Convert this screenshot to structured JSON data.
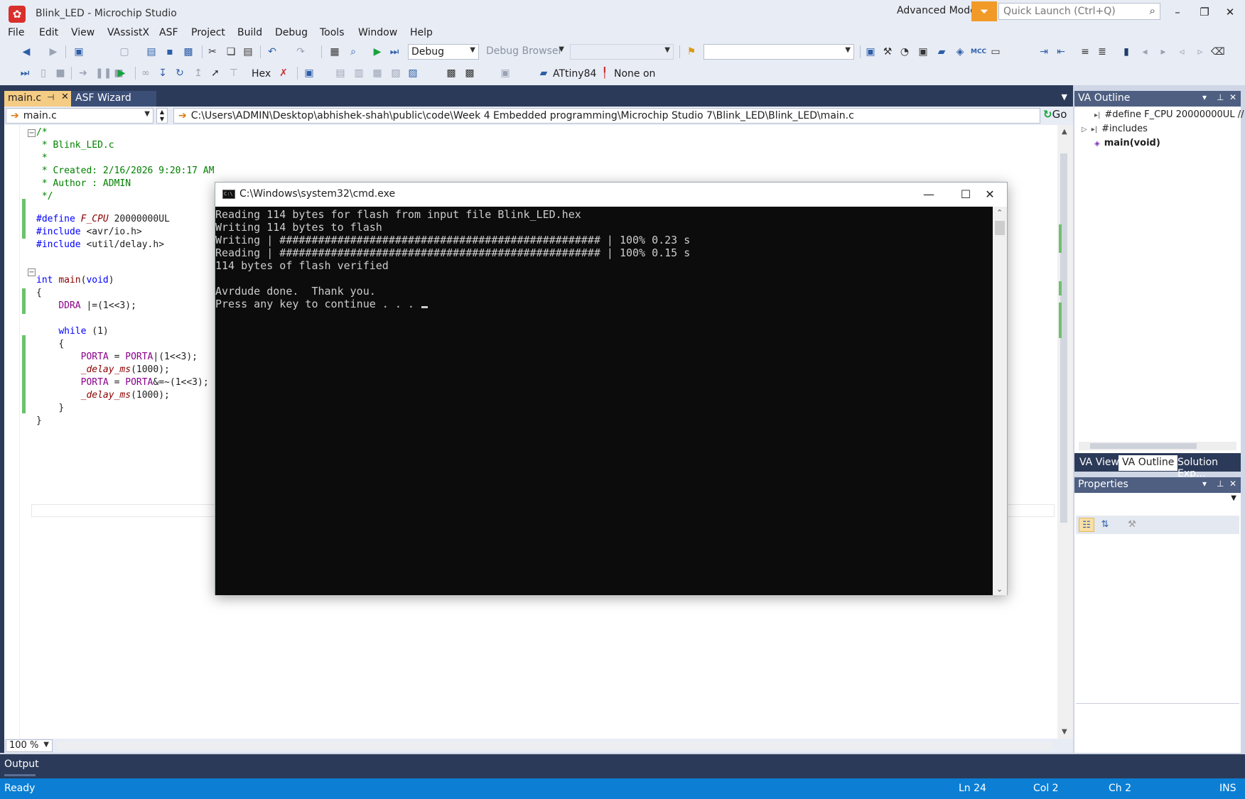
{
  "window": {
    "title": "Blink_LED - Microchip Studio",
    "advanced_mode": "Advanced Mode",
    "quick_launch_placeholder": "Quick Launch (Ctrl+Q)"
  },
  "menu": [
    "File",
    "Edit",
    "View",
    "VAssistX",
    "ASF",
    "Project",
    "Build",
    "Debug",
    "Tools",
    "Window",
    "Help"
  ],
  "toolbar": {
    "config": "Debug",
    "debug_browser": "Debug Browser",
    "hex_label": "Hex",
    "device": "ATtiny84",
    "tool": "None on"
  },
  "tabs": {
    "main": "main.c",
    "asf": "ASF Wizard"
  },
  "navbar": {
    "file": "main.c",
    "path": "C:\\Users\\ADMIN\\Desktop\\abhishek-shah\\public\\code\\Week 4 Embedded programming\\Microchip Studio 7\\Blink_LED\\Blink_LED\\main.c",
    "go": "Go"
  },
  "code": {
    "l1": "/*",
    "l2": " * Blink_LED.c",
    "l3": " *",
    "l4": " * Created: 2/16/2026 9:20:17 AM",
    "l5": " * Author : ADMIN",
    "l6": " */",
    "define_kw": "#define",
    "define_name": "F_CPU",
    "define_val": " 20000000UL",
    "inc_kw": "#include",
    "inc1": " <avr/io.h>",
    "inc2": " <util/delay.h>",
    "int_kw": "int",
    "main_name": "main",
    "main_args": "(",
    "void_kw": "void",
    "close_paren": ")",
    "brace_open": "{",
    "ddra": "DDRA",
    "ddra_rest": " |=(1<<3);",
    "while_kw": "while",
    "while_rest": " (1)",
    "inner_open": "{",
    "porta": "PORTA",
    "eq": " = ",
    "or_rest": "|(1<<3);",
    "delay": "_delay_ms",
    "delay_arg": "(1000);",
    "and_rest": "&=~(1<<3);",
    "inner_close": "}",
    "brace_close": "}"
  },
  "zoom": "100 %",
  "va_outline": {
    "title": "VA Outline",
    "items": [
      "#define F_CPU 20000000UL  //",
      "#includes",
      "main(void)"
    ]
  },
  "panel_tabs": [
    "VA View",
    "VA Outline",
    "Solution Exp..."
  ],
  "properties": {
    "title": "Properties"
  },
  "output": "Output",
  "status": {
    "ready": "Ready",
    "ln": "Ln 24",
    "col": "Col 2",
    "ch": "Ch 2",
    "ins": "INS"
  },
  "cmd": {
    "title": "C:\\Windows\\system32\\cmd.exe",
    "lines": [
      "Reading 114 bytes for flash from input file Blink_LED.hex",
      "Writing 114 bytes to flash",
      "Writing | ################################################## | 100% 0.23 s",
      "Reading | ################################################## | 100% 0.15 s",
      "114 bytes of flash verified",
      "",
      "Avrdude done.  Thank you.",
      "Press any key to continue . . . "
    ]
  }
}
